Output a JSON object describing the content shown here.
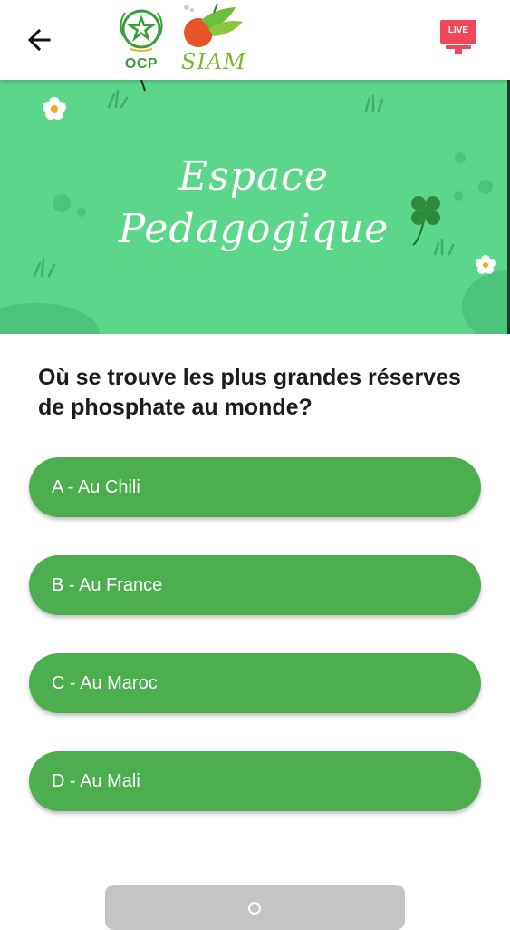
{
  "header": {
    "back_icon": "arrow-left-icon",
    "logos": {
      "ocp": "OCP",
      "siam": "SIAM"
    },
    "live_label": "LIVE",
    "colors": {
      "ocp_green": "#3a9e3a",
      "siam_green": "#7cb62f",
      "live_red": "#f0475a"
    }
  },
  "banner": {
    "title_line1": "Espace",
    "title_line2": "Pedagogique",
    "background": "#5bd68b"
  },
  "quiz": {
    "question": "Où se trouve les plus grandes réserves de phosphate au monde?",
    "answers": [
      {
        "label": "A - Au Chili"
      },
      {
        "label": "B - Au France"
      },
      {
        "label": "C - Au Maroc"
      },
      {
        "label": "D - Au Mali"
      }
    ],
    "answer_color": "#4cae4f"
  }
}
